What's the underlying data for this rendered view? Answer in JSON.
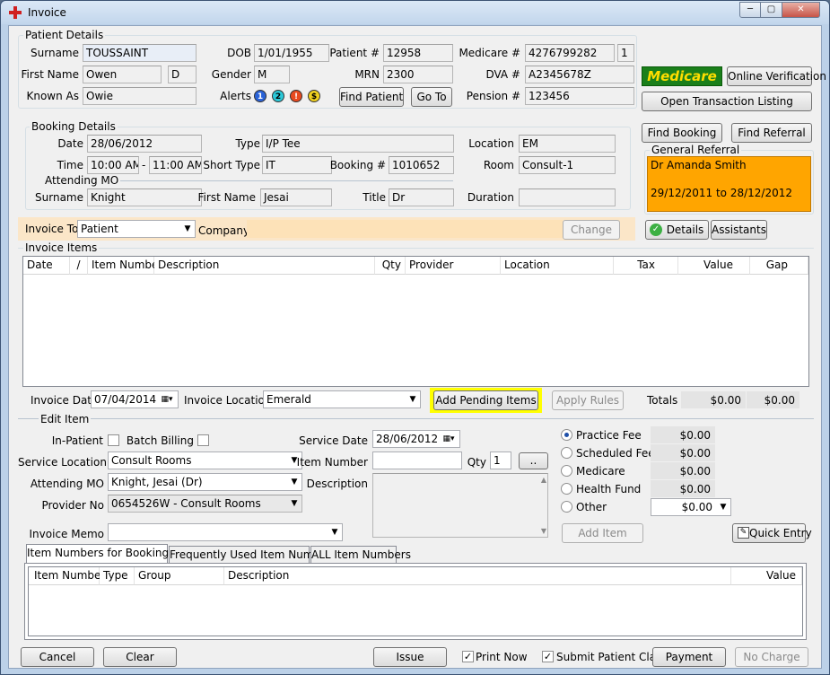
{
  "window": {
    "title": "Invoice",
    "controls": {
      "minimize": "─",
      "maximize": "▢",
      "close": "✕"
    }
  },
  "patient": {
    "group": "Patient Details",
    "surname_label": "Surname",
    "surname": "TOUSSAINT",
    "first_name_label": "First Name",
    "first_name": "Owen",
    "middle_initial": "D",
    "known_as_label": "Known As",
    "known_as": "Owie",
    "dob_label": "DOB",
    "dob": "1/01/1955",
    "gender_label": "Gender",
    "gender": "M",
    "alerts_label": "Alerts",
    "alerts": [
      "1",
      "2",
      "!",
      "$"
    ],
    "patient_no_label": "Patient #",
    "patient_no": "12958",
    "mrn_label": "MRN",
    "mrn": "2300",
    "medicare_label": "Medicare #",
    "medicare": "4276799282",
    "medicare_irn": "1",
    "dva_label": "DVA #",
    "dva": "A2345678Z",
    "pension_label": "Pension #",
    "pension": "123456",
    "find_patient": "Find Patient",
    "go_to": "Go To",
    "medicare_logo": "Medicare",
    "online_verification": "Online Verification",
    "open_transaction_listing": "Open Transaction Listing"
  },
  "booking": {
    "group": "Booking Details",
    "date_label": "Date",
    "date": "28/06/2012",
    "time_label": "Time",
    "time_from": "10:00 AM",
    "time_sep": "-",
    "time_to": "11:00 AM",
    "type_label": "Type",
    "type": "I/P Tee",
    "short_type_label": "Short Type",
    "short_type": "IT",
    "booking_no_label": "Booking #",
    "booking_no": "1010652",
    "location_label": "Location",
    "location": "EM",
    "room_label": "Room",
    "room": "Consult-1",
    "attending_group": "Attending MO",
    "surname_label": "Surname",
    "surname": "Knight",
    "first_name_label": "First Name",
    "first_name": "Jesai",
    "title_label": "Title",
    "title": "Dr",
    "duration_label": "Duration",
    "duration": "",
    "find_booking": "Find Booking",
    "find_referral": "Find Referral",
    "referral_group": "General Referral",
    "referral_doctor": "Dr Amanda Smith",
    "referral_period": "29/12/2011 to 28/12/2012"
  },
  "invoice_to": {
    "label": "Invoice To",
    "value": "Patient",
    "company_label": "Company",
    "company": "",
    "change": "Change",
    "details": "Details",
    "assistants": "Assistants"
  },
  "invoice_items": {
    "group": "Invoice Items",
    "columns": [
      "Date",
      "/",
      "Item Number",
      "Description",
      "Qty",
      "Provider",
      "Location",
      "Tax",
      "Value",
      "Gap"
    ],
    "invoice_date_label": "Invoice Date",
    "invoice_date": "07/04/2014",
    "invoice_location_label": "Invoice Location",
    "invoice_location": "Emerald",
    "add_pending_items": "Add Pending Items",
    "apply_rules": "Apply Rules",
    "totals_label": "Totals",
    "total_value": "$0.00",
    "total_gap": "$0.00"
  },
  "edit_item": {
    "group": "Edit Item",
    "in_patient_label": "In-Patient",
    "batch_billing_label": "Batch Billing",
    "service_location_label": "Service Location",
    "service_location": "Consult Rooms",
    "attending_mo_label": "Attending MO",
    "attending_mo": "Knight, Jesai (Dr)",
    "provider_no_label": "Provider No",
    "provider_no": "0654526W - Consult Rooms",
    "invoice_memo_label": "Invoice Memo",
    "invoice_memo": "",
    "service_date_label": "Service Date",
    "service_date": "28/06/2012",
    "item_number_label": "Item Number",
    "item_number": "",
    "qty_label": "Qty",
    "qty": "1",
    "browse": "..",
    "description_label": "Description",
    "fees": [
      {
        "label": "Practice Fee",
        "value": "$0.00"
      },
      {
        "label": "Scheduled Fee",
        "value": "$0.00"
      },
      {
        "label": "Medicare",
        "value": "$0.00"
      },
      {
        "label": "Health Fund",
        "value": "$0.00"
      },
      {
        "label": "Other",
        "value": "$0.00"
      }
    ],
    "add_item": "Add Item",
    "quick_entry": "Quick Entry"
  },
  "tabs": [
    "Item Numbers for Booking Type",
    "Frequently Used Item Numbers",
    "ALL Item Numbers"
  ],
  "item_columns": [
    "Item Number",
    "Type",
    "Group",
    "Description",
    "Value"
  ],
  "footer": {
    "cancel": "Cancel",
    "clear": "Clear",
    "issue": "Issue",
    "print_now": "Print Now",
    "submit_claim": "Submit Patient Claim",
    "payment": "Payment",
    "no_charge": "No Charge"
  },
  "colors": {
    "referral_bg": "#ffa500",
    "invoice_to_bg": "#fbe6c8",
    "highlight": "#ffff00",
    "medicare_green": "#1a7f1a",
    "medicare_yellow": "#ffdd00"
  }
}
